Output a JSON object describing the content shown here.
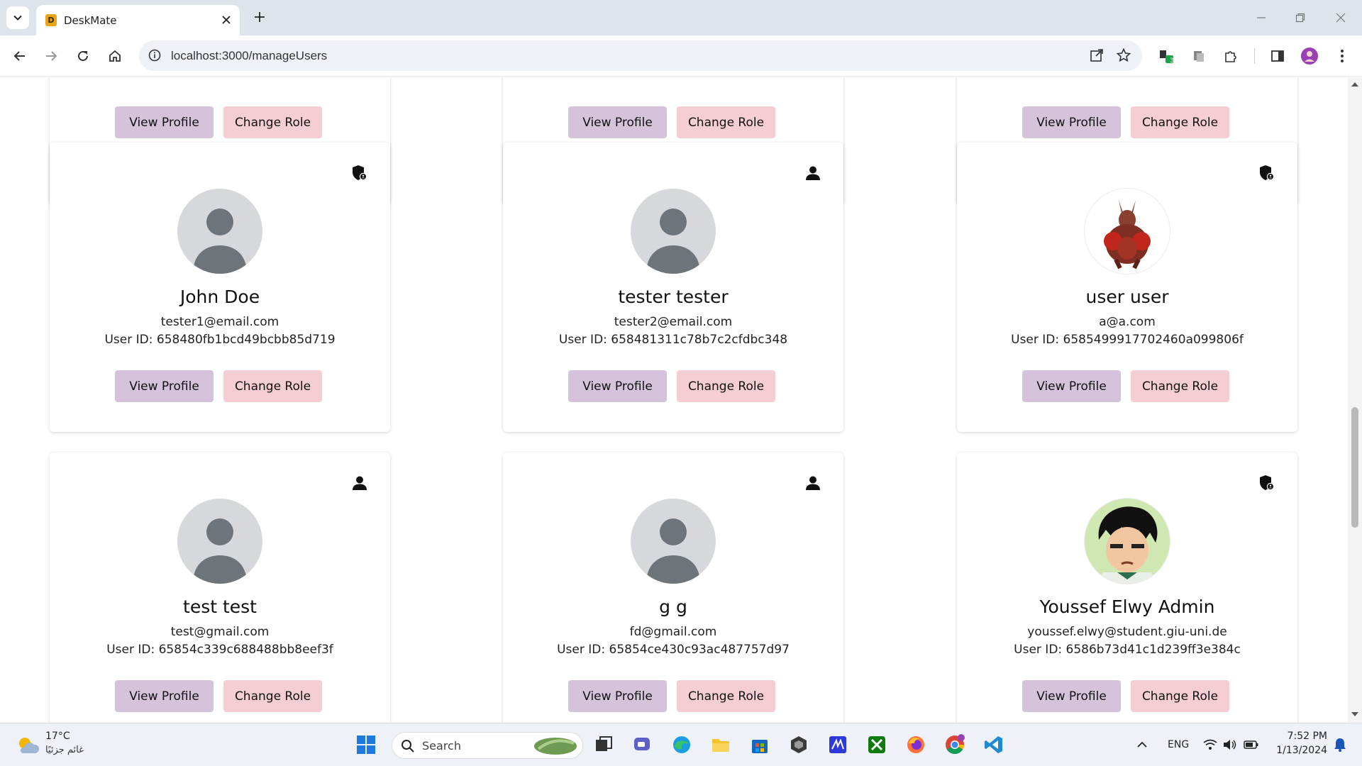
{
  "browser": {
    "tab_title": "DeskMate",
    "favicon_letter": "D",
    "url": "localhost:3000/manageUsers",
    "extension_badge": "3"
  },
  "partial_row": [
    {
      "view_label": "View Profile",
      "role_label": "Change Role"
    },
    {
      "view_label": "View Profile",
      "role_label": "Change Role"
    },
    {
      "view_label": "View Profile",
      "role_label": "Change Role"
    }
  ],
  "users": [
    {
      "name": "John Doe",
      "email": "tester1@email.com",
      "user_id": "User ID: 658480fb1bcd49bcbb85d719",
      "role_icon": "admin-shield-icon",
      "avatar": "default-avatar",
      "view_label": "View Profile",
      "role_label": "Change Role"
    },
    {
      "name": "tester tester",
      "email": "tester2@email.com",
      "user_id": "User ID: 658481311c78b7c2cfdbc348",
      "role_icon": "user-person-icon",
      "avatar": "default-avatar",
      "view_label": "View Profile",
      "role_label": "Change Role"
    },
    {
      "name": "user user",
      "email": "a@a.com",
      "user_id": "User ID: 6585499917702460a099806f",
      "role_icon": "admin-shield-icon",
      "avatar": "red-creature-avatar",
      "view_label": "View Profile",
      "role_label": "Change Role"
    },
    {
      "name": "test test",
      "email": "test@gmail.com",
      "user_id": "User ID: 65854c339c688488bb8eef3f",
      "role_icon": "user-person-icon",
      "avatar": "default-avatar",
      "view_label": "View Profile",
      "role_label": "Change Role"
    },
    {
      "name": "g g",
      "email": "fd@gmail.com",
      "user_id": "User ID: 65854ce430c93ac487757d97",
      "role_icon": "user-person-icon",
      "avatar": "default-avatar",
      "view_label": "View Profile",
      "role_label": "Change Role"
    },
    {
      "name": "Youssef Elwy Admin",
      "email": "youssef.elwy@student.giu-uni.de",
      "user_id": "User ID: 6586b73d41c1d239ff3e384c",
      "role_icon": "admin-shield-icon",
      "avatar": "cartoon-boy-avatar",
      "view_label": "View Profile",
      "role_label": "Change Role"
    }
  ],
  "taskbar": {
    "weather_temp": "17°C",
    "weather_cond": "غائم جزئيًا",
    "search_label": "Search",
    "language": "ENG",
    "time": "7:52 PM",
    "date": "1/13/2024"
  },
  "colors": {
    "view_button": "#d5c3dc",
    "change_role_button": "#f5cdd5",
    "avatar_placeholder": "#d7d8db"
  }
}
